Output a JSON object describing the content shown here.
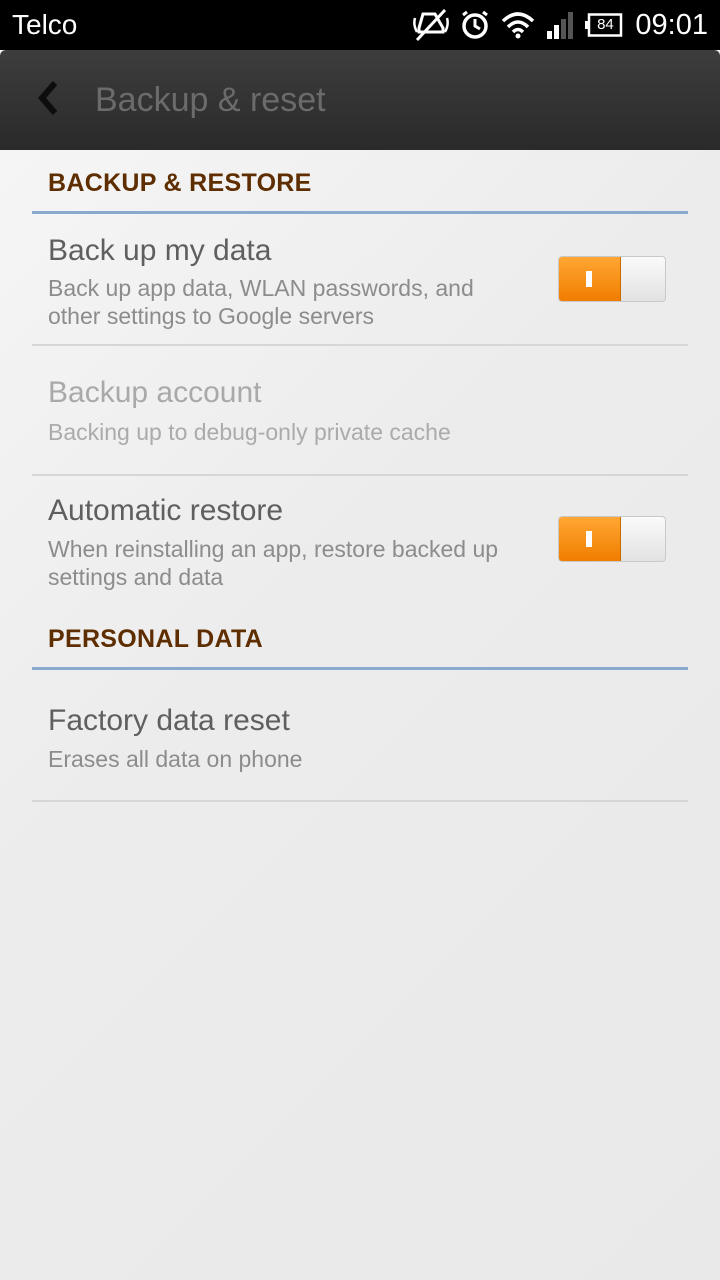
{
  "status_bar": {
    "carrier": "Telco",
    "battery": "84",
    "time": "09:01",
    "icons": [
      "silent-icon",
      "alarm-icon",
      "wifi-icon",
      "signal-icon",
      "battery-icon"
    ]
  },
  "action_bar": {
    "title": "Backup & reset",
    "back_icon": "back-chevron-icon"
  },
  "sections": {
    "backup_restore": {
      "header": "BACKUP & RESTORE",
      "back_up_data": {
        "title": "Back up my data",
        "summary": "Back up app data, WLAN passwords, and other settings to Google servers",
        "enabled": true
      },
      "backup_account": {
        "title": "Backup account",
        "summary": "Backing up to debug-only private cache"
      },
      "automatic_restore": {
        "title": "Automatic restore",
        "summary": "When reinstalling an app, restore backed up settings and data",
        "enabled": true
      }
    },
    "personal_data": {
      "header": "PERSONAL DATA",
      "factory_reset": {
        "title": "Factory data reset",
        "summary": "Erases all data on phone"
      }
    }
  },
  "colors": {
    "accent_orange": "#f58a0c",
    "section_header": "#5e2e00",
    "section_rule": "#8aa9cf",
    "action_bar": "#333333"
  }
}
